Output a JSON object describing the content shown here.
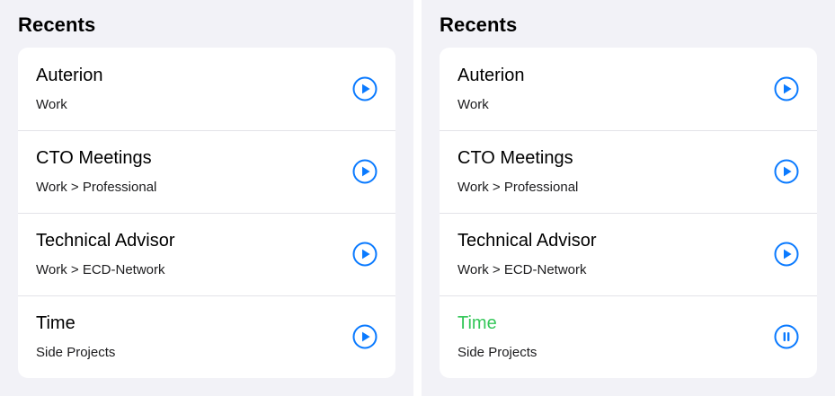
{
  "accent_color": "#0a7aff",
  "active_color": "#34c759",
  "panels": [
    {
      "section_title": "Recents",
      "items": [
        {
          "title": "Auterion",
          "subtitle": "Work",
          "control_icon": "play-icon",
          "active": false
        },
        {
          "title": "CTO Meetings",
          "subtitle": "Work > Professional",
          "control_icon": "play-icon",
          "active": false
        },
        {
          "title": "Technical Advisor",
          "subtitle": "Work > ECD-Network",
          "control_icon": "play-icon",
          "active": false
        },
        {
          "title": "Time",
          "subtitle": "Side Projects",
          "control_icon": "play-icon",
          "active": false
        }
      ]
    },
    {
      "section_title": "Recents",
      "items": [
        {
          "title": "Auterion",
          "subtitle": "Work",
          "control_icon": "play-icon",
          "active": false
        },
        {
          "title": "CTO Meetings",
          "subtitle": "Work > Professional",
          "control_icon": "play-icon",
          "active": false
        },
        {
          "title": "Technical Advisor",
          "subtitle": "Work > ECD-Network",
          "control_icon": "play-icon",
          "active": false
        },
        {
          "title": "Time",
          "subtitle": "Side Projects",
          "control_icon": "pause-icon",
          "active": true
        }
      ]
    }
  ]
}
